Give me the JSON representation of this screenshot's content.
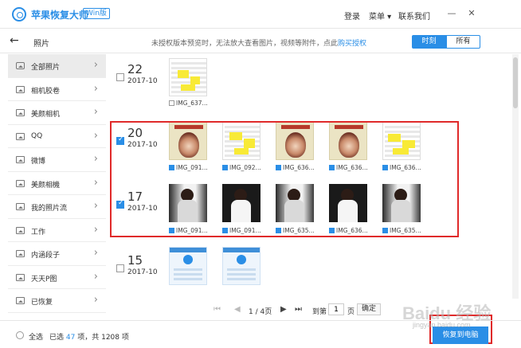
{
  "app": {
    "title": "苹果恢复大师",
    "edition": "Win版",
    "login": "登录",
    "menu": "菜单 ▾",
    "contact": "联系我们",
    "minimize": "—",
    "close": "✕"
  },
  "nav": {
    "back": "←",
    "page_title": "照片",
    "notice": "未授权版本预览时，无法放大查看图片，视频等附件，点此",
    "notice_link": "购买授权",
    "view_toggle": [
      "时刻",
      "所有"
    ]
  },
  "sidebar": {
    "items": [
      {
        "label": "全部照片",
        "active": true
      },
      {
        "label": "相机胶卷"
      },
      {
        "label": "美颜相机"
      },
      {
        "label": "QQ"
      },
      {
        "label": "微博"
      },
      {
        "label": "美颜相機"
      },
      {
        "label": "我的照片流"
      },
      {
        "label": "工作"
      },
      {
        "label": "内涵段子"
      },
      {
        "label": "天天P图"
      },
      {
        "label": "已恢复"
      }
    ]
  },
  "groups": [
    {
      "day": "22",
      "month": "2017-10",
      "checked": false,
      "photos": [
        {
          "caption": "IMG_637...",
          "checked": false
        }
      ]
    },
    {
      "day": "20",
      "month": "2017-10",
      "checked": true,
      "photos": [
        {
          "caption": "IMG_091...",
          "checked": true
        },
        {
          "caption": "IMG_092...",
          "checked": true
        },
        {
          "caption": "IMG_636...",
          "checked": true
        },
        {
          "caption": "IMG_636...",
          "checked": true
        },
        {
          "caption": "IMG_636...",
          "checked": true
        }
      ]
    },
    {
      "day": "17",
      "month": "2017-10",
      "checked": true,
      "photos": [
        {
          "caption": "IMG_091...",
          "checked": true
        },
        {
          "caption": "IMG_091...",
          "checked": true
        },
        {
          "caption": "IMG_635...",
          "checked": true
        },
        {
          "caption": "IMG_636...",
          "checked": true
        },
        {
          "caption": "IMG_635...",
          "checked": true
        }
      ]
    },
    {
      "day": "15",
      "month": "2017-10",
      "checked": false,
      "photos": [
        {
          "caption": "",
          "checked": false
        },
        {
          "caption": "",
          "checked": false
        }
      ]
    }
  ],
  "pager": {
    "current": "1 / 4页",
    "goto_label": "到第",
    "goto_value": "1",
    "page_unit": "页",
    "confirm": "确定"
  },
  "footer": {
    "select_all": "全选",
    "selected_prefix": "已选",
    "selected_count": "47",
    "selected_mid": "项，共",
    "total_count": "1208",
    "total_suffix": "项",
    "recover": "恢复到电脑"
  },
  "watermark": {
    "text": "Baidu 经验",
    "sub": "jingyan.baidu.com"
  },
  "colors": {
    "accent": "#2a8ee6",
    "highlight": "#e02a2a"
  }
}
